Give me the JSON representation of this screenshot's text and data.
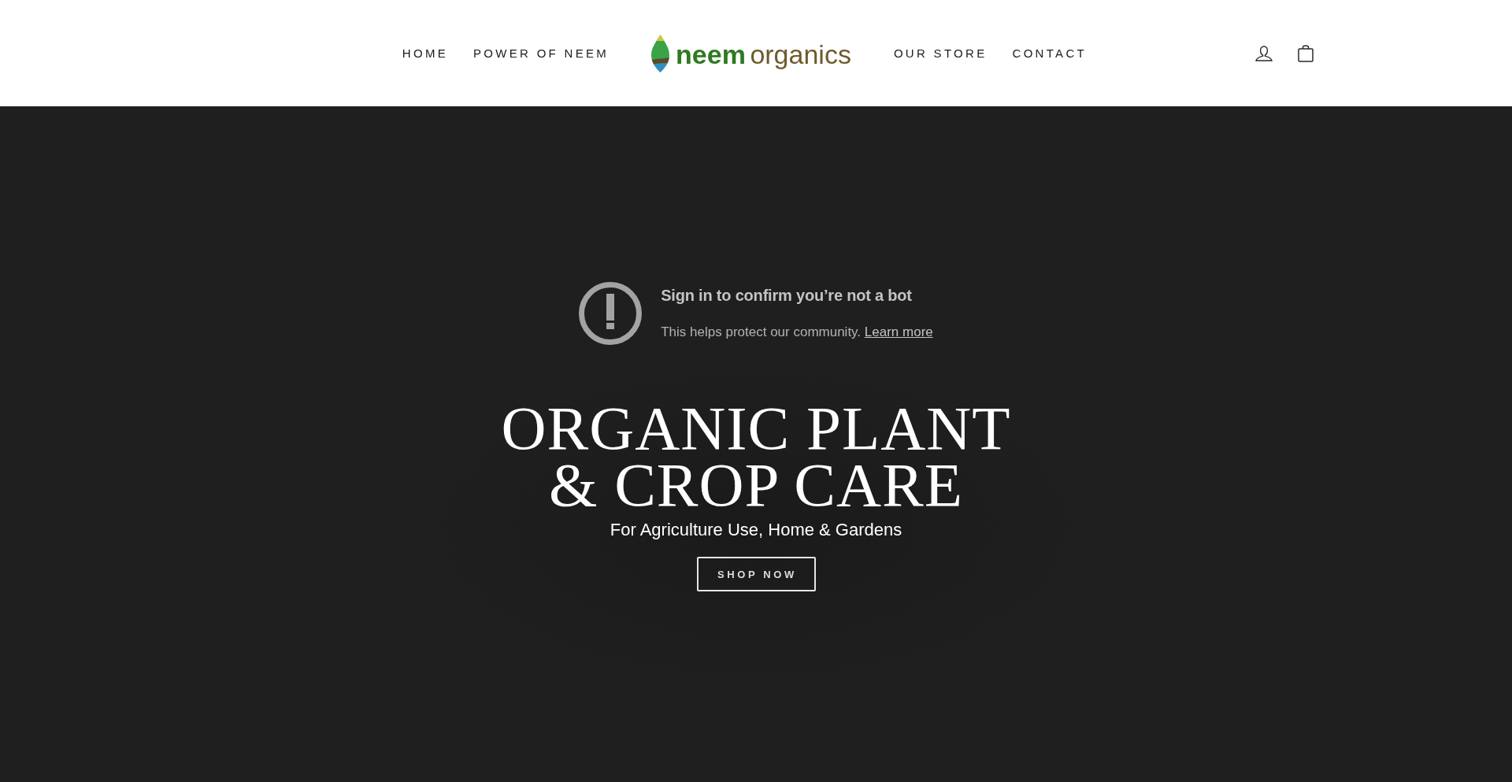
{
  "header": {
    "nav_left": [
      {
        "label": "HOME"
      },
      {
        "label": "POWER OF NEEM"
      }
    ],
    "logo": {
      "word_1": "neem",
      "word_2": "organics"
    },
    "nav_right": [
      {
        "label": "OUR STORE"
      },
      {
        "label": "CONTACT"
      }
    ]
  },
  "notice": {
    "title": "Sign in to confirm you’re not a bot",
    "text": "This helps protect our community.",
    "link": "Learn more"
  },
  "hero": {
    "title_lines": [
      "ORGANIC PLANT",
      "& CROP CARE"
    ],
    "subtitle": "For Agriculture Use, Home & Gardens",
    "button": "SHOP NOW"
  }
}
